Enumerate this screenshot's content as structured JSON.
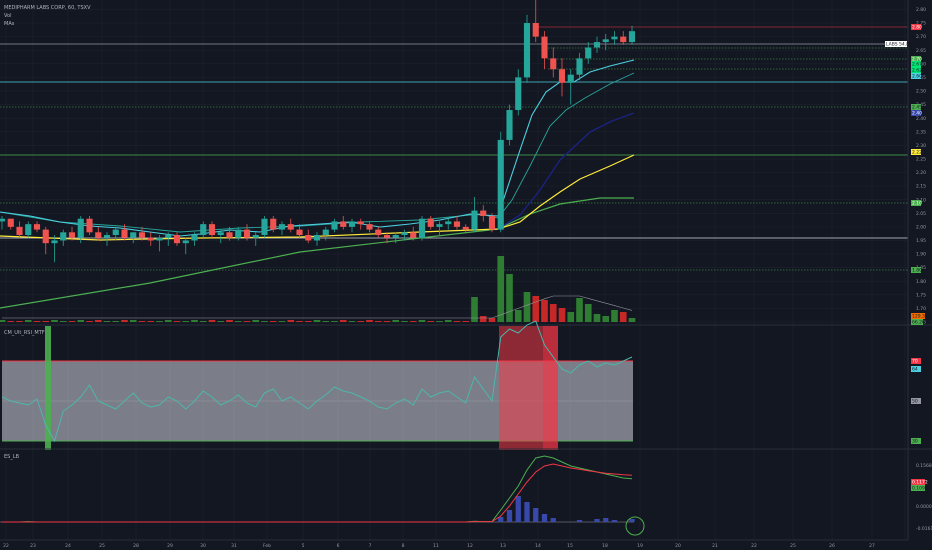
{
  "legend": {
    "symbol": "MEDIPHARM LABS CORP, 60, TSXV",
    "line2": "Vol",
    "line3": "MAs"
  },
  "rsi_pane": {
    "title": "CM_Ult_RSI_MTF"
  },
  "lb_pane": {
    "title": "ES_LB"
  },
  "time_axis": {
    "labels": [
      "22",
      "23",
      "24",
      "25",
      "28",
      "29",
      "30",
      "31",
      "Feb",
      "5",
      "6",
      "7",
      "8",
      "11",
      "12",
      "13",
      "14",
      "15",
      "18",
      "19",
      "20",
      "21",
      "22",
      "25",
      "26",
      "27"
    ]
  },
  "price_axis": {
    "labels": [
      "2.80",
      "2.75",
      "2.70",
      "2.65",
      "2.60",
      "2.55",
      "2.50",
      "2.45",
      "2.40",
      "2.35",
      "2.30",
      "2.25",
      "2.20",
      "2.15",
      "2.10",
      "2.05",
      "2.00",
      "1.95",
      "1.90",
      "1.85",
      "1.80",
      "1.75",
      "1.70",
      "1.65"
    ]
  },
  "tags": {
    "red_level": "2.80",
    "last_price": "LABS 54.8% | 2.72",
    "green_1": "2.70",
    "green_2": "2.67",
    "green_3": "2.62",
    "green_4": "2.60",
    "green_5": "2.45",
    "blue_ma": "2.40",
    "yellow_ma": "2.22",
    "green_6": "2.10",
    "green_7": "1.80",
    "volume": "129.35K",
    "volume_ma": "66.26",
    "rsi_upper": "70",
    "rsi_value": "64",
    "rsi_mid": "50",
    "rsi_lower": "30",
    "lb_top": "0.1568",
    "lb_red": "0.1172",
    "lb_green": "0.1092",
    "lb_mid": "0.0000",
    "lb_bottom": "-0.0161"
  },
  "colors": {
    "background": "#131722",
    "up": "#26a69a",
    "down": "#ef5350",
    "ma_fast": "#4dd0e1",
    "ma_mid": "#26a69a",
    "ma_blue": "#1a237e",
    "ma_yellow": "#ffeb3b",
    "ma_green": "#4caf50",
    "level_green": "#4caf50",
    "level_red": "#f23645",
    "rsi_line": "#4db6ac",
    "rsi_band": "#d1d4dc"
  },
  "chart_data": {
    "type": "line",
    "title": "MEDIPHARM LABS CORP, 60, TSXV",
    "y_range": [
      1.65,
      2.82
    ],
    "candle_key": [
      [
        2.02,
        2.04,
        1.99,
        2.03
      ],
      [
        2.03,
        2.03,
        1.99,
        2.0
      ],
      [
        2.0,
        2.02,
        1.96,
        1.97
      ],
      [
        1.97,
        2.02,
        1.96,
        2.01
      ],
      [
        2.01,
        2.02,
        1.98,
        1.99
      ],
      [
        1.99,
        2.0,
        1.9,
        1.94
      ],
      [
        1.94,
        1.97,
        1.87,
        1.95
      ],
      [
        1.95,
        1.99,
        1.93,
        1.98
      ],
      [
        1.98,
        2.0,
        1.95,
        1.96
      ],
      [
        1.96,
        2.04,
        1.94,
        2.03
      ],
      [
        2.03,
        2.04,
        1.97,
        1.98
      ],
      [
        1.98,
        2.0,
        1.95,
        1.96
      ],
      [
        1.96,
        1.98,
        1.93,
        1.97
      ],
      [
        1.97,
        2.0,
        1.95,
        1.99
      ],
      [
        1.99,
        2.01,
        1.95,
        1.96
      ],
      [
        1.96,
        1.98,
        1.94,
        1.98
      ],
      [
        1.98,
        2.0,
        1.95,
        1.96
      ],
      [
        1.96,
        1.98,
        1.93,
        1.95
      ],
      [
        1.95,
        1.97,
        1.91,
        1.96
      ],
      [
        1.96,
        1.98,
        1.93,
        1.97
      ],
      [
        1.97,
        1.98,
        1.93,
        1.94
      ],
      [
        1.94,
        1.96,
        1.9,
        1.95
      ],
      [
        1.95,
        1.98,
        1.93,
        1.97
      ],
      [
        1.97,
        2.02,
        1.96,
        2.01
      ],
      [
        2.01,
        2.02,
        1.96,
        1.97
      ],
      [
        1.97,
        1.99,
        1.94,
        1.98
      ],
      [
        1.98,
        2.0,
        1.95,
        1.96
      ],
      [
        1.96,
        2.0,
        1.95,
        1.99
      ],
      [
        1.99,
        2.01,
        1.95,
        1.96
      ],
      [
        1.96,
        1.98,
        1.93,
        1.97
      ],
      [
        1.97,
        2.04,
        1.96,
        2.03
      ],
      [
        2.03,
        2.04,
        1.98,
        1.99
      ],
      [
        1.99,
        2.02,
        1.97,
        2.01
      ],
      [
        2.01,
        2.03,
        1.98,
        1.99
      ],
      [
        1.99,
        2.01,
        1.96,
        1.97
      ],
      [
        1.97,
        1.99,
        1.94,
        1.95
      ],
      [
        1.95,
        1.98,
        1.93,
        1.97
      ],
      [
        1.97,
        2.0,
        1.95,
        1.99
      ],
      [
        1.99,
        2.03,
        1.98,
        2.02
      ],
      [
        2.02,
        2.04,
        1.99,
        2.0
      ],
      [
        2.0,
        2.03,
        1.98,
        2.02
      ],
      [
        2.02,
        2.03,
        1.99,
        2.01
      ],
      [
        2.01,
        2.02,
        1.98,
        1.99
      ],
      [
        1.99,
        2.0,
        1.96,
        1.97
      ],
      [
        1.97,
        1.98,
        1.94,
        1.96
      ],
      [
        1.96,
        1.98,
        1.94,
        1.97
      ],
      [
        1.97,
        1.99,
        1.95,
        1.98
      ],
      [
        1.98,
        2.0,
        1.95,
        1.96
      ],
      [
        1.96,
        2.04,
        1.95,
        2.03
      ],
      [
        2.03,
        2.04,
        1.99,
        2.0
      ],
      [
        2.0,
        2.02,
        1.97,
        2.01
      ],
      [
        2.01,
        2.03,
        1.99,
        2.02
      ],
      [
        2.02,
        2.04,
        1.99,
        2.0
      ],
      [
        2.0,
        2.01,
        1.98,
        1.99
      ],
      [
        1.99,
        2.11,
        1.98,
        2.06
      ],
      [
        2.06,
        2.08,
        2.02,
        2.04
      ],
      [
        2.04,
        2.05,
        1.98,
        1.99
      ],
      [
        1.99,
        2.35,
        1.98,
        2.32
      ],
      [
        2.32,
        2.45,
        2.3,
        2.43
      ],
      [
        2.43,
        2.58,
        2.41,
        2.55
      ],
      [
        2.55,
        2.78,
        2.53,
        2.75
      ],
      [
        2.75,
        2.85,
        2.68,
        2.7
      ],
      [
        2.7,
        2.72,
        2.58,
        2.62
      ],
      [
        2.62,
        2.66,
        2.55,
        2.58
      ],
      [
        2.58,
        2.62,
        2.48,
        2.53
      ],
      [
        2.53,
        2.58,
        2.45,
        2.56
      ],
      [
        2.56,
        2.64,
        2.54,
        2.62
      ],
      [
        2.62,
        2.68,
        2.6,
        2.66
      ],
      [
        2.66,
        2.7,
        2.64,
        2.68
      ],
      [
        2.68,
        2.71,
        2.65,
        2.69
      ],
      [
        2.69,
        2.72,
        2.67,
        2.7
      ],
      [
        2.7,
        2.72,
        2.67,
        2.68
      ],
      [
        2.68,
        2.74,
        2.67,
        2.72
      ]
    ]
  }
}
